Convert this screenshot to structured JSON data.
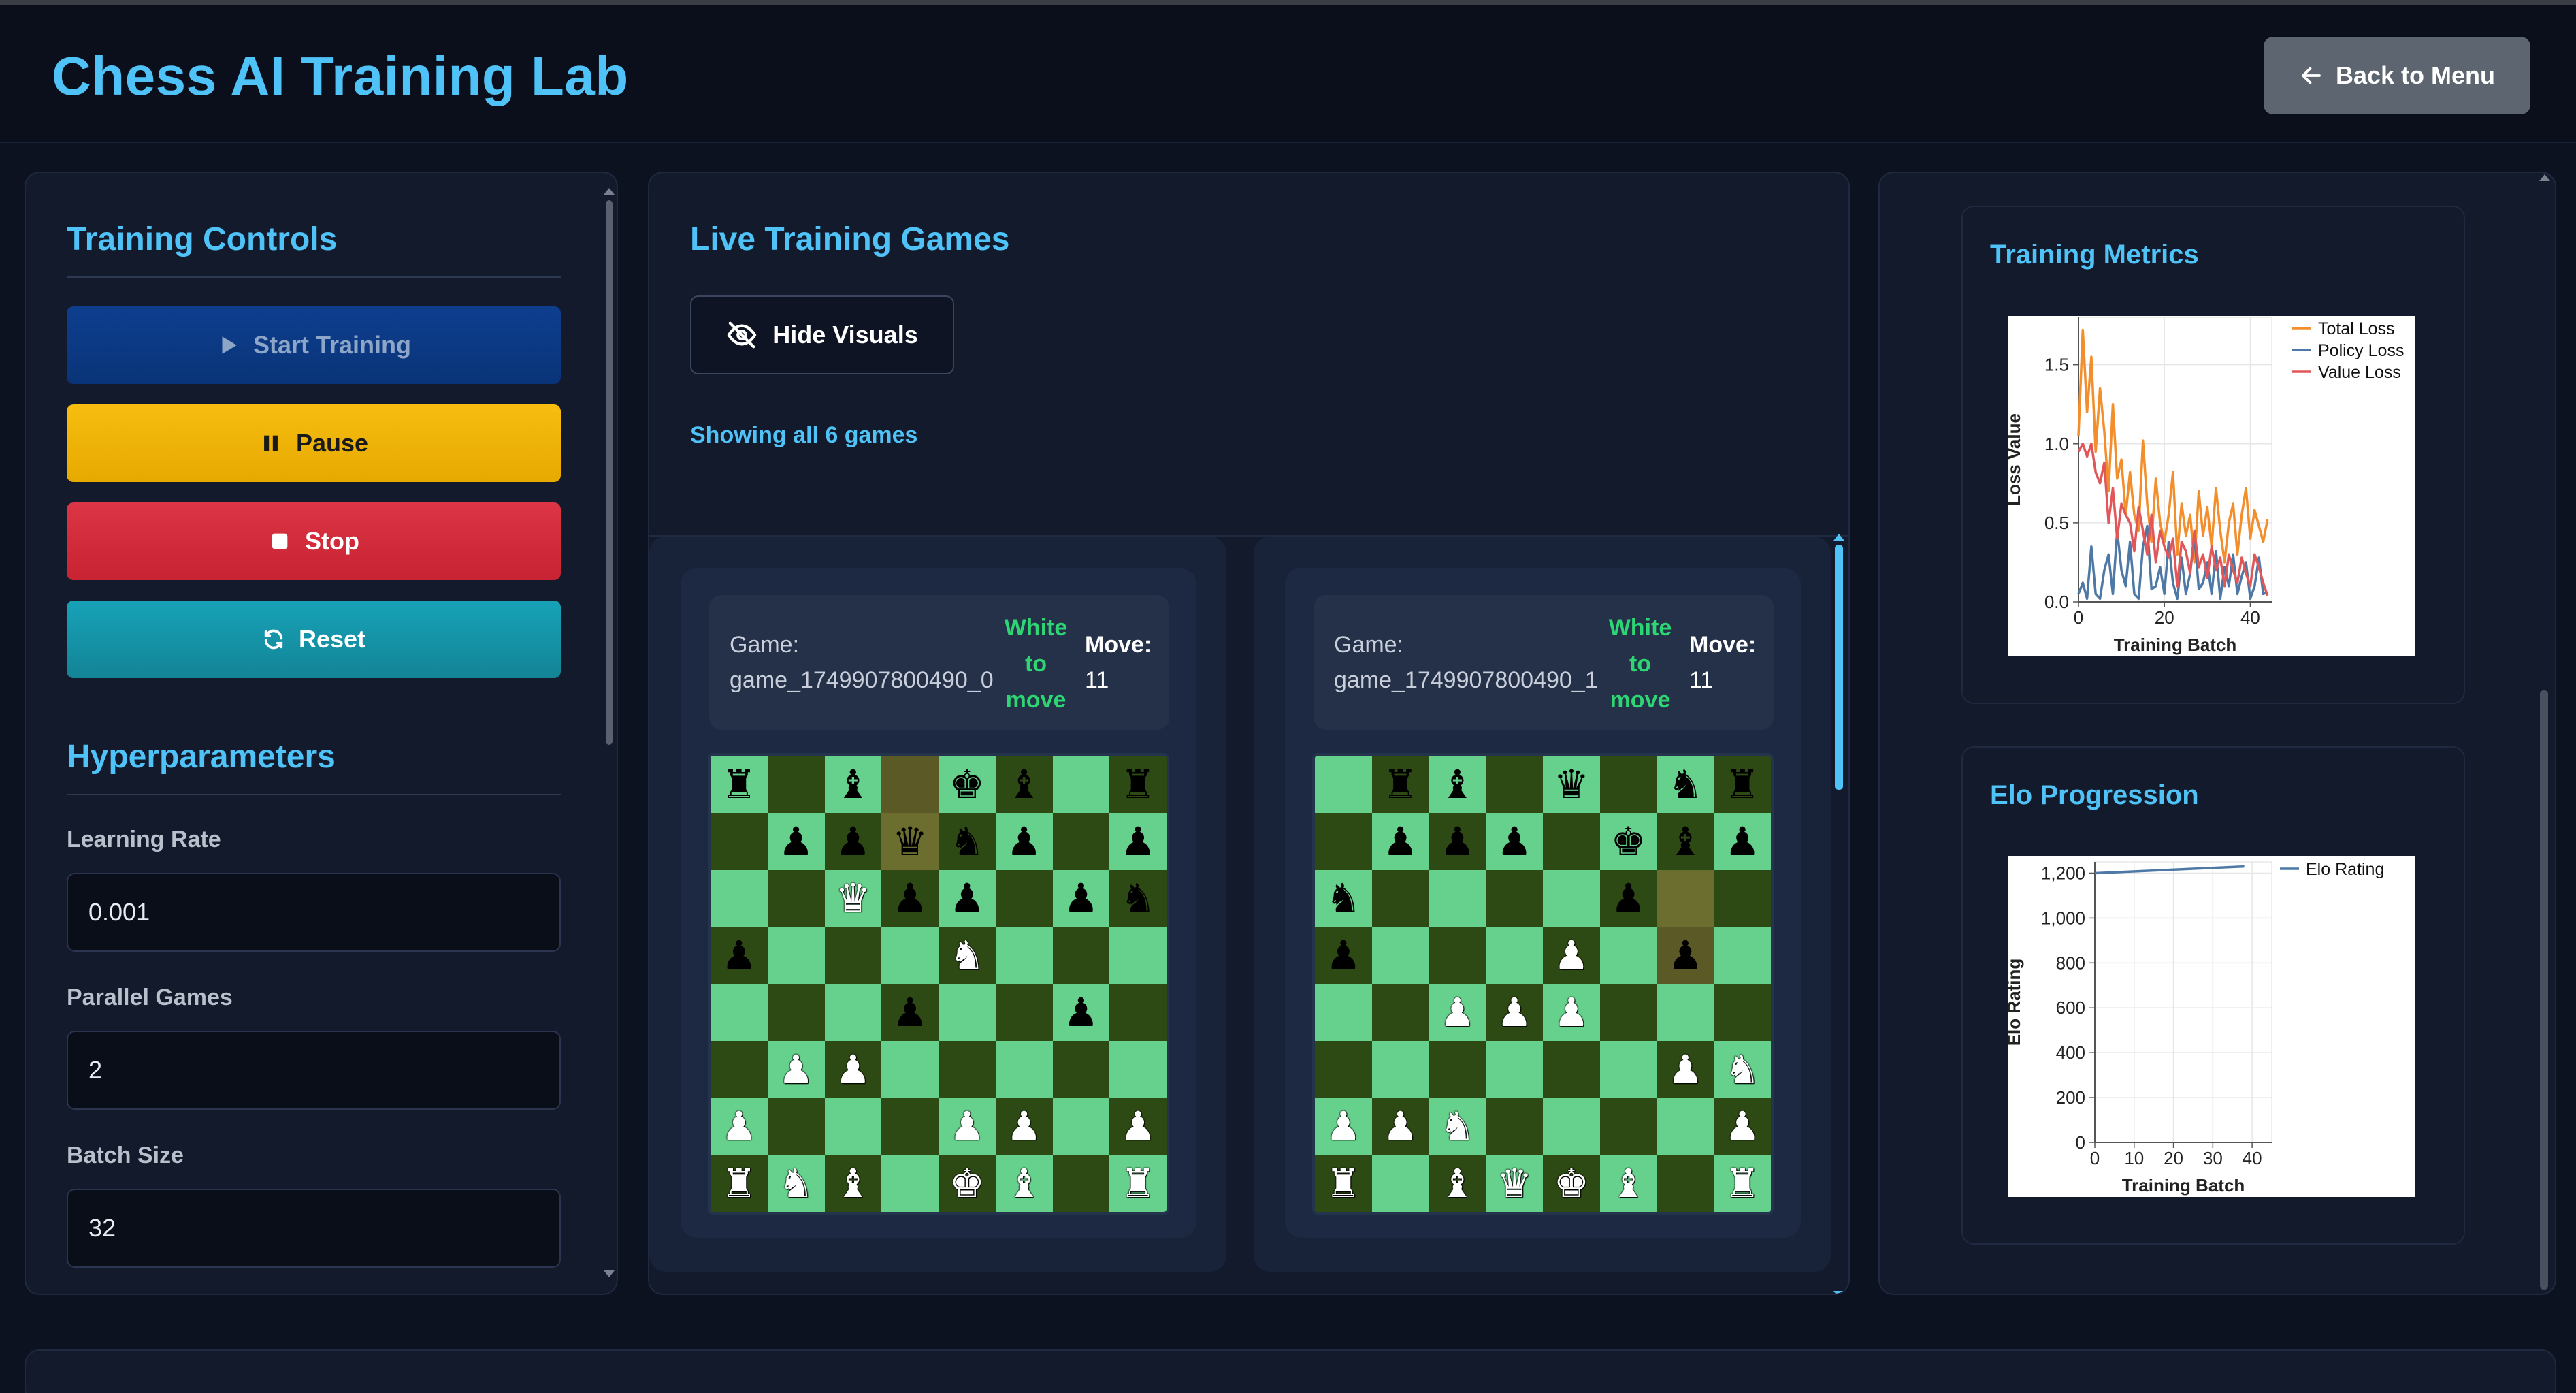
{
  "app": {
    "title": "Chess AI Training Lab",
    "back_label": "Back to Menu"
  },
  "controls": {
    "title": "Training Controls",
    "start_label": "Start Training",
    "pause_label": "Pause",
    "stop_label": "Stop",
    "reset_label": "Reset"
  },
  "hyperparameters": {
    "title": "Hyperparameters",
    "learning_rate_label": "Learning Rate",
    "learning_rate_value": "0.001",
    "parallel_games_label": "Parallel Games",
    "parallel_games_value": "2",
    "batch_size_label": "Batch Size",
    "batch_size_value": "32"
  },
  "games": {
    "title": "Live Training Games",
    "hide_visuals_label": "Hide Visuals",
    "showing_text": "Showing all 6 games",
    "list": [
      {
        "game_label": "Game:",
        "id": "game_1749907800490_0",
        "turn": "White to move",
        "move_label": "Move:",
        "move_number": "11",
        "board": [
          "r.b.kb.r",
          ".ppqnp.p",
          "..Qpp.pn",
          "p...N...",
          "...p..p.",
          ".PP.....",
          "P...PP.P",
          "RNB.KB.R"
        ],
        "highlight": [
          [
            0,
            3
          ],
          [
            1,
            3
          ]
        ]
      },
      {
        "game_label": "Game:",
        "id": "game_1749907800490_1",
        "turn": "White to move",
        "move_label": "Move:",
        "move_number": "11",
        "board": [
          ".rb.q.nr",
          ".ppp.kbp",
          "n....p..",
          "p...P.p.",
          "..PPP...",
          "......PN",
          "PPN....P",
          "R.BQKB.R"
        ],
        "highlight": [
          [
            2,
            6
          ],
          [
            3,
            6
          ]
        ]
      }
    ]
  },
  "metrics": {
    "title": "Training Metrics",
    "elo_title": "Elo Progression"
  },
  "chart_data": [
    {
      "type": "line",
      "title": "",
      "xlabel": "Training Batch",
      "ylabel": "Loss Value",
      "xlim": [
        0,
        45
      ],
      "ylim": [
        0,
        1.8
      ],
      "xticks": [
        0,
        20,
        40
      ],
      "yticks": [
        0.0,
        0.5,
        1.0,
        1.5
      ],
      "grid": true,
      "legend": "top-right",
      "series": [
        {
          "name": "Total Loss",
          "color": "#f28e2b",
          "values": [
            1.05,
            1.72,
            1.2,
            1.55,
            0.95,
            1.35,
            1.08,
            0.7,
            1.25,
            0.78,
            0.9,
            0.55,
            0.82,
            0.55,
            0.45,
            1.02,
            0.62,
            0.38,
            0.78,
            0.5,
            0.38,
            0.55,
            0.82,
            0.3,
            0.62,
            0.42,
            0.55,
            0.25,
            0.7,
            0.42,
            0.6,
            0.35,
            0.72,
            0.45,
            0.25,
            0.5,
            0.62,
            0.3,
            0.55,
            0.72,
            0.4,
            0.58,
            0.48,
            0.38,
            0.52
          ]
        },
        {
          "name": "Policy Loss",
          "color": "#4e79a7",
          "values": [
            0.05,
            0.12,
            0.02,
            0.35,
            0.05,
            0.02,
            0.2,
            0.3,
            0.05,
            0.45,
            0.2,
            0.1,
            0.38,
            0.05,
            0.02,
            0.35,
            0.48,
            0.08,
            0.1,
            0.22,
            0.05,
            0.38,
            0.12,
            0.02,
            0.28,
            0.05,
            0.18,
            0.42,
            0.08,
            0.12,
            0.25,
            0.05,
            0.32,
            0.02,
            0.22,
            0.1,
            0.3,
            0.05,
            0.16,
            0.25,
            0.02,
            0.1,
            0.28,
            0.05,
            0.06
          ]
        },
        {
          "name": "Value Loss",
          "color": "#e15759",
          "values": [
            0.95,
            1.0,
            0.92,
            1.0,
            0.82,
            0.75,
            0.88,
            0.5,
            0.72,
            0.4,
            0.62,
            0.55,
            0.5,
            0.32,
            0.6,
            0.45,
            0.3,
            0.55,
            0.25,
            0.45,
            0.35,
            0.28,
            0.4,
            0.1,
            0.38,
            0.32,
            0.18,
            0.45,
            0.22,
            0.3,
            0.15,
            0.35,
            0.2,
            0.28,
            0.1,
            0.3,
            0.2,
            0.12,
            0.28,
            0.18,
            0.1,
            0.3,
            0.22,
            0.12,
            0.04
          ]
        }
      ]
    },
    {
      "type": "line",
      "title": "",
      "xlabel": "Training Batch",
      "ylabel": "Elo Rating",
      "xlim": [
        0,
        45
      ],
      "ylim": [
        0,
        1250
      ],
      "xticks": [
        0,
        10,
        20,
        30,
        40
      ],
      "yticks": [
        0,
        200,
        400,
        600,
        800,
        1000,
        1200
      ],
      "grid": true,
      "legend": "top-right",
      "series": [
        {
          "name": "Elo Rating",
          "color": "#4e79a7",
          "x": [
            0,
            38
          ],
          "values": [
            1200,
            1230
          ]
        }
      ]
    }
  ]
}
